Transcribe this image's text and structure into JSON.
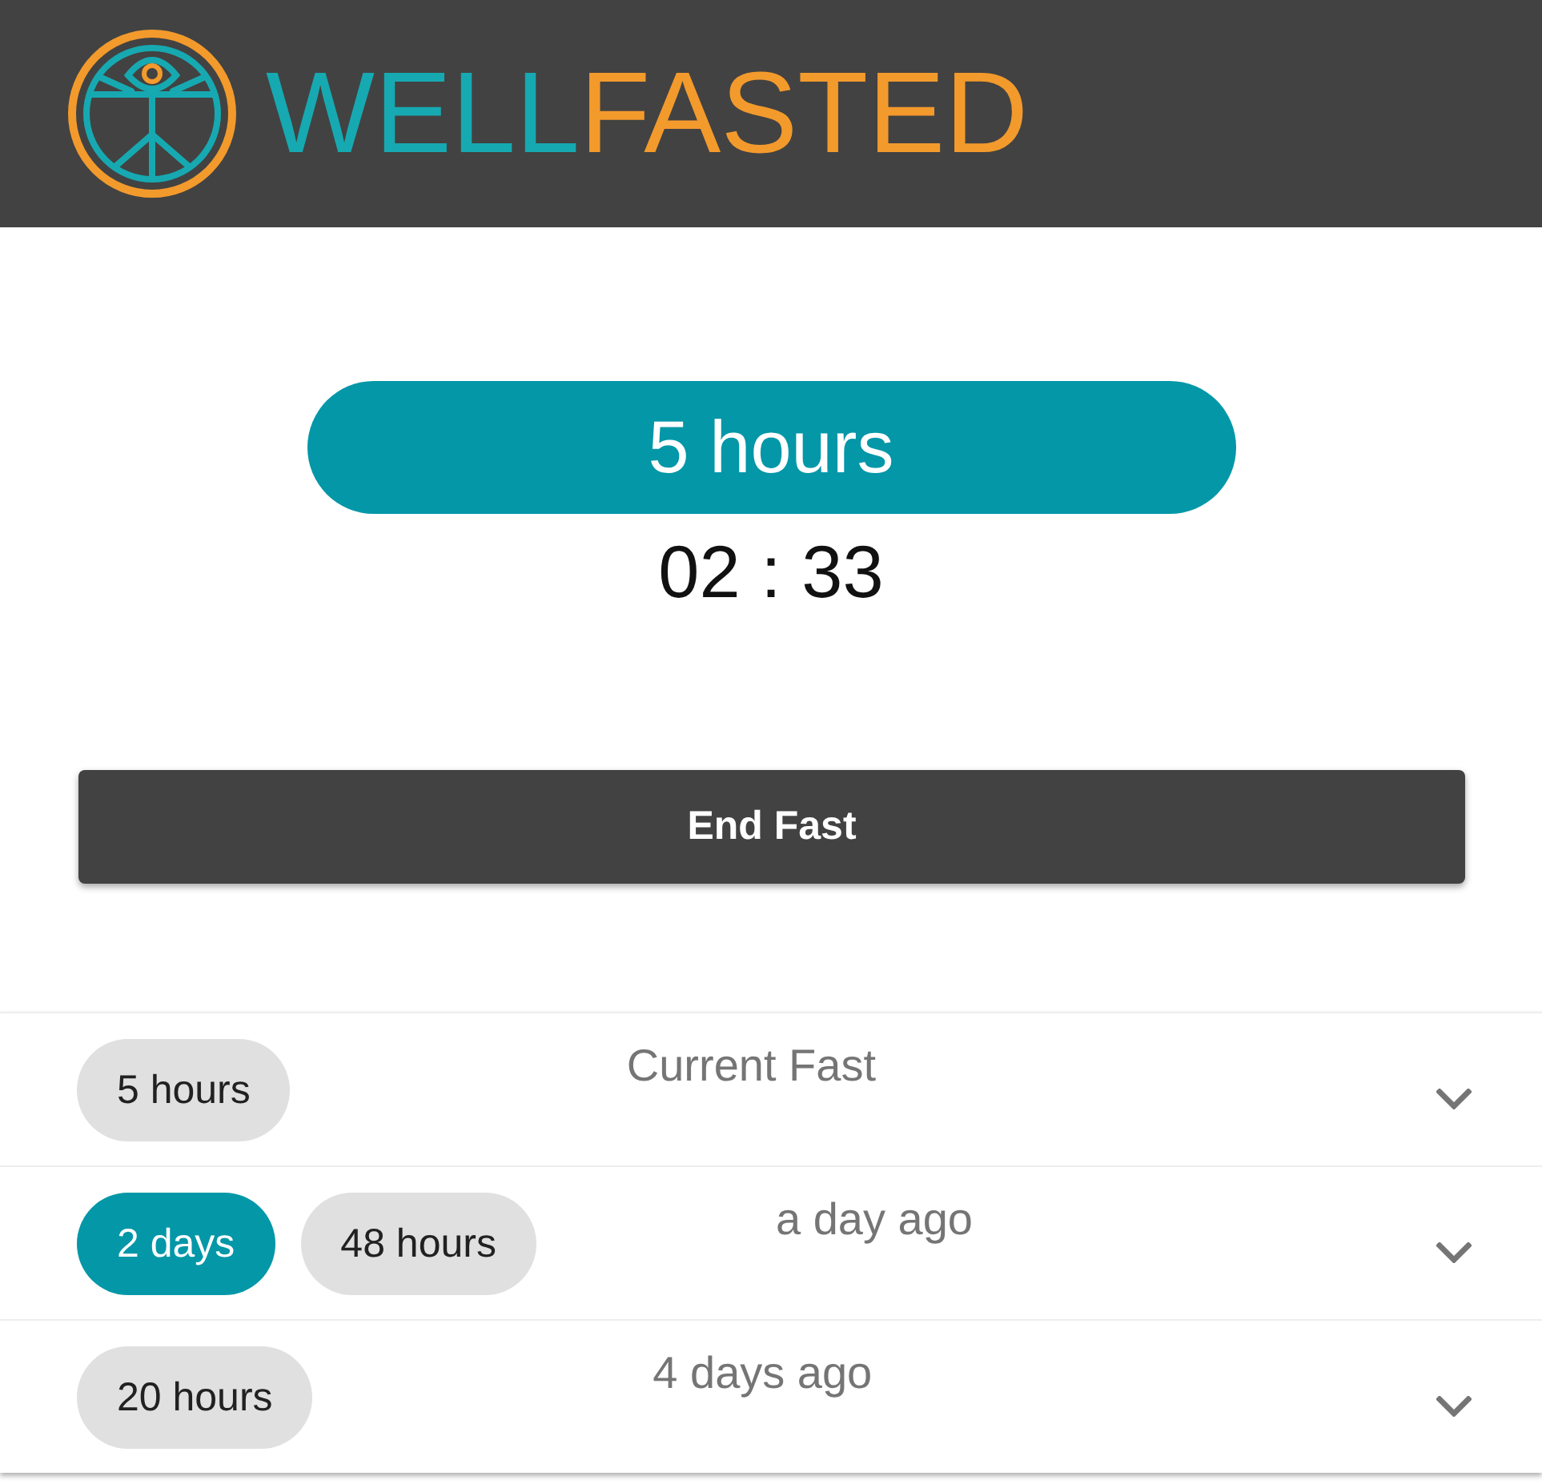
{
  "header": {
    "logo": {
      "wordmark": [
        {
          "text": "WELL",
          "color": "#17a9b1"
        },
        {
          "text": "FASTED",
          "color": "#f39a2c"
        }
      ]
    }
  },
  "current_fast": {
    "goal": "5 hours",
    "elapsed": "02 : 33"
  },
  "end_button": {
    "label": "End Fast"
  },
  "history": [
    {
      "chips": [
        {
          "label": "5 hours",
          "highlighted": false
        }
      ],
      "title": "Current Fast",
      "expanded": false
    },
    {
      "chips": [
        {
          "label": "2 days",
          "highlighted": true
        },
        {
          "label": "48 hours",
          "highlighted": false
        }
      ],
      "title": "a day ago",
      "expanded": false
    },
    {
      "chips": [
        {
          "label": "20 hours",
          "highlighted": false
        }
      ],
      "title": "4 days ago",
      "expanded": false
    }
  ]
}
